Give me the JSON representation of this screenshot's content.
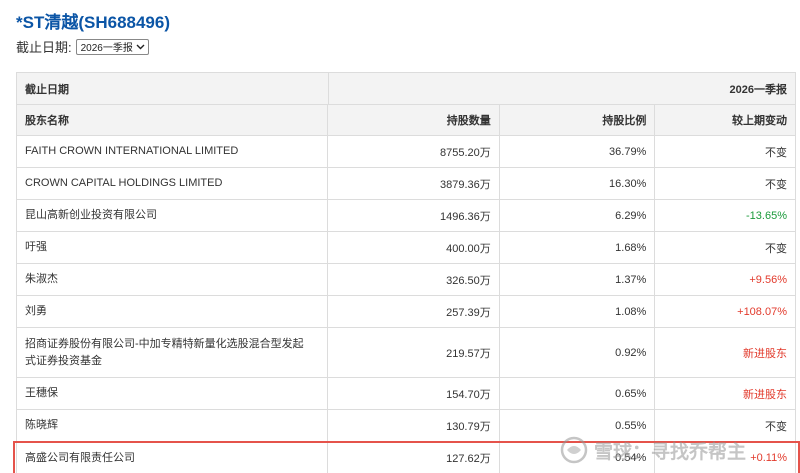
{
  "header": {
    "title": "*ST清越(SH688496)",
    "date_label": "截止日期:",
    "date_value": "2026一季报"
  },
  "table": {
    "period_label": "截止日期",
    "period_value": "2026一季报",
    "columns": [
      "股东名称",
      "持股数量",
      "持股比例",
      "较上期变动"
    ],
    "rows": [
      {
        "name": "FAITH CROWN INTERNATIONAL LIMITED",
        "shares": "8755.20万",
        "ratio": "36.79%",
        "change": "不变"
      },
      {
        "name": "CROWN CAPITAL HOLDINGS LIMITED",
        "shares": "3879.36万",
        "ratio": "16.30%",
        "change": "不变"
      },
      {
        "name": "昆山高新创业投资有限公司",
        "shares": "1496.36万",
        "ratio": "6.29%",
        "change": "-13.65%"
      },
      {
        "name": "吁强",
        "shares": "400.00万",
        "ratio": "1.68%",
        "change": "不变"
      },
      {
        "name": "朱淑杰",
        "shares": "326.50万",
        "ratio": "1.37%",
        "change": "+9.56%"
      },
      {
        "name": "刘勇",
        "shares": "257.39万",
        "ratio": "1.08%",
        "change": "+108.07%"
      },
      {
        "name_line1": "招商证券股份有限公司-中加专精特新量化选股混合型发起",
        "name_line2": "式证券投资基金",
        "shares": "219.57万",
        "ratio": "0.92%",
        "change": "新进股东"
      },
      {
        "name": "王穗保",
        "shares": "154.70万",
        "ratio": "0.65%",
        "change": "新进股东"
      },
      {
        "name": "陈晓辉",
        "shares": "130.79万",
        "ratio": "0.55%",
        "change": "不变"
      },
      {
        "name": "高盛公司有限责任公司",
        "shares": "127.62万",
        "ratio": "0.54%",
        "change": "+0.11%"
      }
    ]
  },
  "watermark": {
    "text": "雪球：寻找乔帮主"
  },
  "colors": {
    "title": "#0b55a6",
    "negative": "#1a9a3a",
    "positive": "#e23a2c",
    "highlight_border": "#e5534b"
  }
}
